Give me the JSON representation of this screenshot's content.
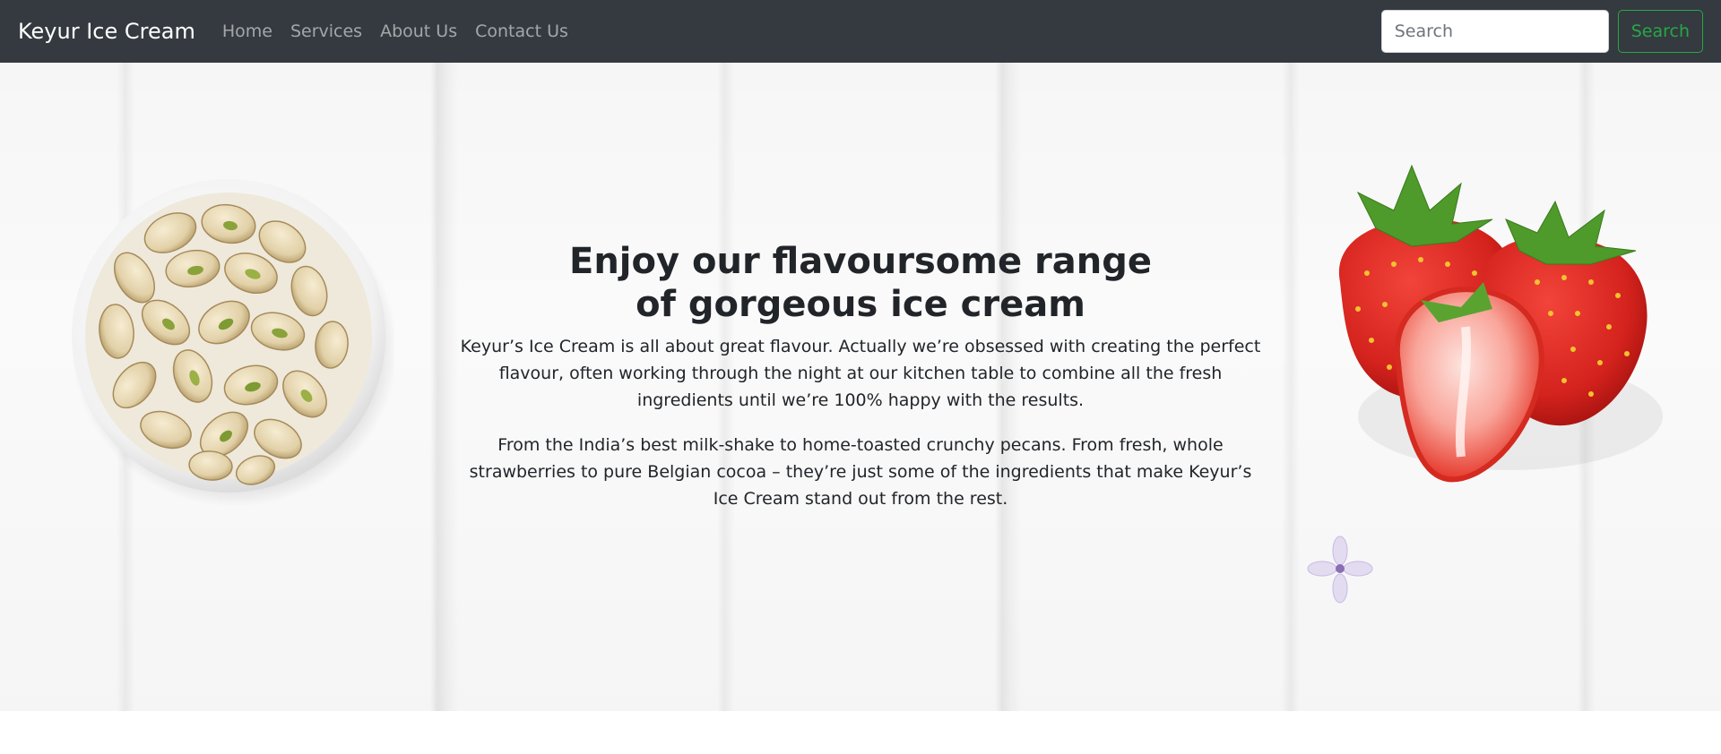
{
  "navbar": {
    "brand": "Keyur Ice Cream",
    "links": [
      {
        "label": "Home"
      },
      {
        "label": "Services"
      },
      {
        "label": "About Us"
      },
      {
        "label": "Contact Us"
      }
    ],
    "search": {
      "placeholder": "Search",
      "button_label": "Search"
    },
    "colors": {
      "background": "#343a40",
      "link": "rgba(255,255,255,0.55)",
      "search_button": "#28a745"
    }
  },
  "hero": {
    "title_line1": "Enjoy our flavoursome range",
    "title_line2": "of gorgeous ice cream",
    "paragraph1": "Keyur’s Ice Cream is all about great flavour. Actually we’re obsessed with creating the perfect flavour, often working through the night at our kitchen table to combine all the fresh ingredients until we’re 100% happy with the results.",
    "paragraph2": "From the India’s best milk-shake to home-toasted crunchy pecans. From fresh, whole strawberries to pure Belgian cocoa – they’re just some of the ingredients that make Keyur’s Ice Cream stand out from the rest.",
    "images": [
      "pistachio-bowl-image",
      "strawberries-image",
      "lilac-flower-image"
    ]
  }
}
